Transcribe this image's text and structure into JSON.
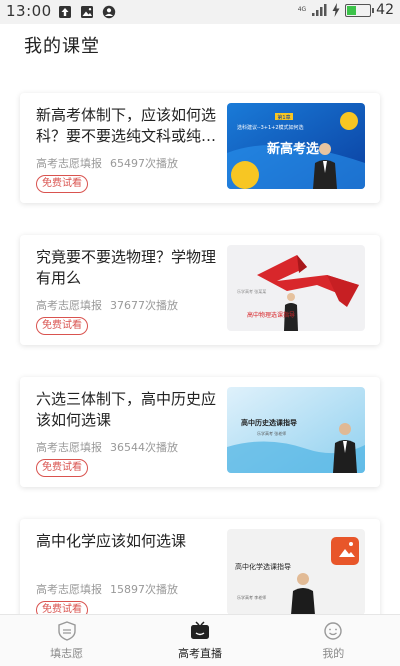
{
  "status_bar": {
    "time": "13:00",
    "network": "4G",
    "battery_level": 0.42,
    "battery_text": "42",
    "left_icons": [
      "upload-icon",
      "image-icon",
      "account-icon"
    ],
    "right_icons": [
      "signal-icon",
      "charging-icon",
      "battery-icon"
    ]
  },
  "header": {
    "title": "我的课堂"
  },
  "courses": [
    {
      "title": "新高考体制下，应该如何选科？要不要选纯文科或纯…",
      "source": "高考志愿填报",
      "plays": "65497次播放",
      "badge": "免费试看",
      "thumb_text": "新高考选",
      "thumb_small": "选科建议--3+1+2模式如何选"
    },
    {
      "title": "究竟要不要选物理？学物理有用么",
      "source": "高考志愿填报",
      "plays": "37677次播放",
      "badge": "免费试看",
      "thumb_text": "高中物理选课指导",
      "thumb_small": ""
    },
    {
      "title": "六选三体制下，高中历史应该如何选课",
      "source": "高考志愿填报",
      "plays": "36544次播放",
      "badge": "免费试看",
      "thumb_text": "高中历史选课指导",
      "thumb_small": ""
    },
    {
      "title": "高中化学应该如何选课",
      "source": "高考志愿填报",
      "plays": "15897次播放",
      "badge": "免费试看",
      "thumb_text": "高中化学选课指导",
      "thumb_small": ""
    }
  ],
  "tab_bar": {
    "tabs": [
      {
        "label": "填志愿",
        "icon": "shield-icon",
        "active": false
      },
      {
        "label": "高考直播",
        "icon": "tv-icon",
        "active": true
      },
      {
        "label": "我的",
        "icon": "smile-icon",
        "active": false
      }
    ]
  }
}
